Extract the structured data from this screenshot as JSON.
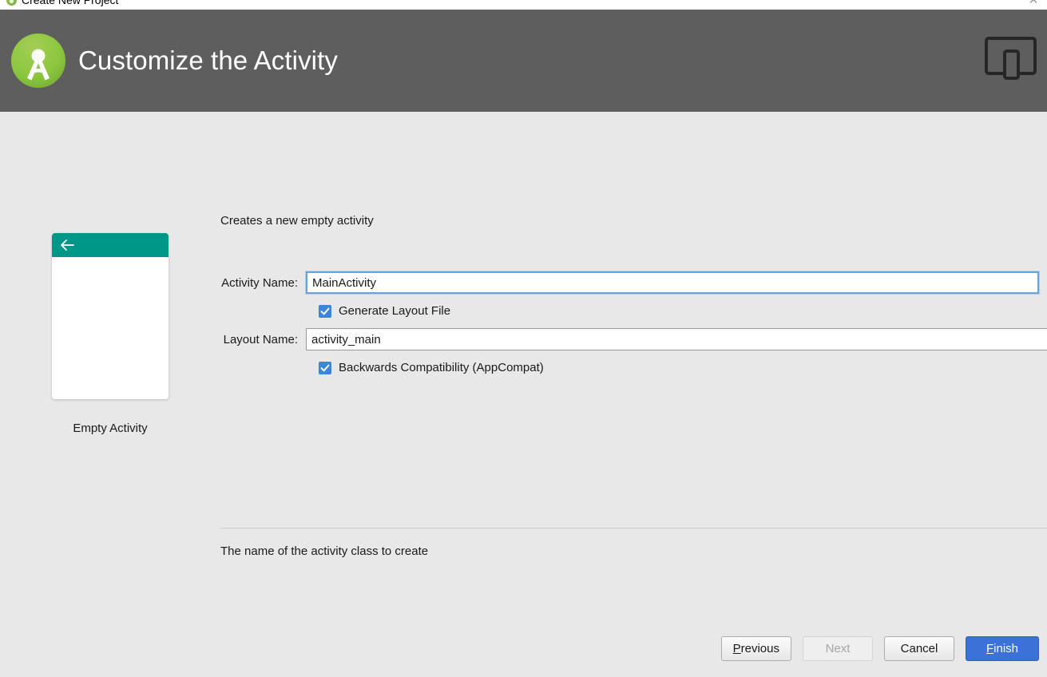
{
  "window": {
    "title": "Create New Project",
    "logo_icon": "android-studio-logo-small",
    "close_icon": "close-icon"
  },
  "header": {
    "title": "Customize the Activity",
    "logo_icon": "android-studio-logo",
    "device_icon": "device-preview-icon",
    "background_color": "#5e5e5e",
    "title_color": "#ffffff"
  },
  "preview": {
    "caption": "Empty Activity",
    "appbar_color": "#009688",
    "back_arrow_icon": "back-arrow-icon"
  },
  "form": {
    "description": "Creates a new empty activity",
    "activity_name": {
      "label": "Activity Name:",
      "value": "MainActivity",
      "placeholder": "MainActivity",
      "focused": true
    },
    "generate_layout": {
      "label": "Generate Layout File",
      "checked": true
    },
    "layout_name": {
      "label": "Layout Name:",
      "value": "activity_main",
      "placeholder": "activity_main",
      "focused": false
    },
    "backwards_compat": {
      "label": "Backwards Compatibility (AppCompat)",
      "checked": true
    },
    "checkbox_color": "#3c86d8",
    "focus_border_color": "#6aa3db"
  },
  "hint": {
    "text": "The name of the activity class to create"
  },
  "footer": {
    "previous": {
      "label": "Previous",
      "mnemonic": "P",
      "enabled": true
    },
    "next": {
      "label": "Next",
      "enabled": false
    },
    "cancel": {
      "label": "Cancel",
      "enabled": true
    },
    "finish": {
      "label": "Finish",
      "mnemonic": "F",
      "enabled": true,
      "primary": true,
      "color": "#3c72d7"
    }
  }
}
